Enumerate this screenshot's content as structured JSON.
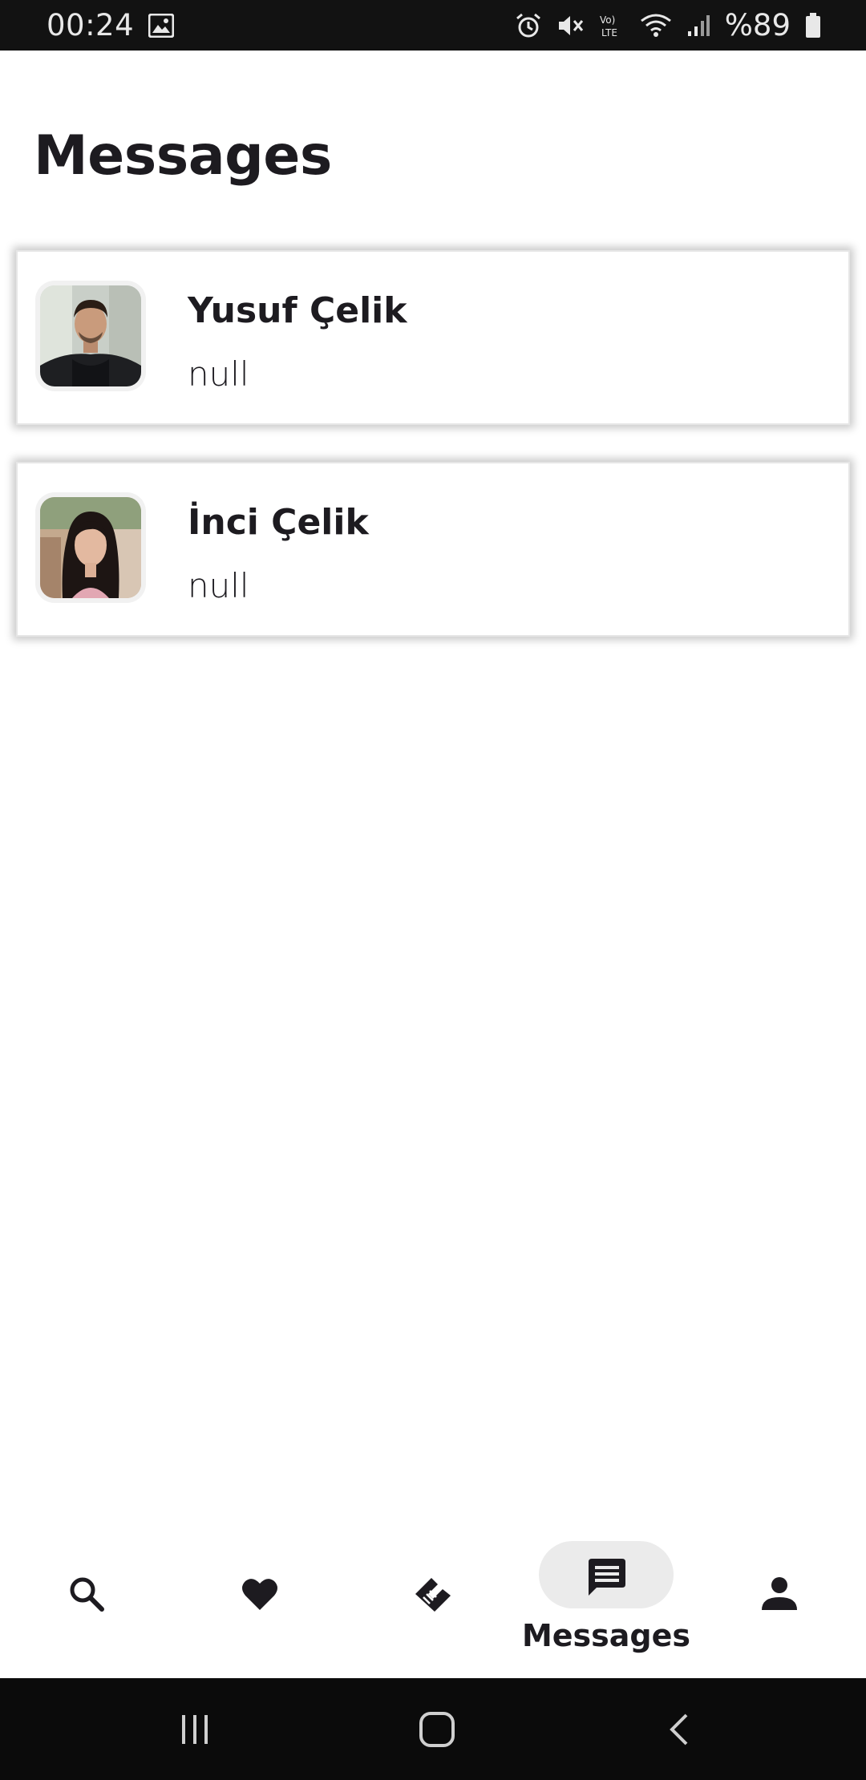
{
  "status_bar": {
    "time": "00:24",
    "battery_label": "%89",
    "icons": [
      "image-icon",
      "alarm-icon",
      "mute-icon",
      "volte-icon",
      "wifi-icon",
      "signal-icon",
      "battery-icon"
    ]
  },
  "page": {
    "title": "Messages"
  },
  "conversations": [
    {
      "name": "Yusuf Çelik",
      "last_message": "null",
      "avatar": "avatar-photo-man"
    },
    {
      "name": "İnci Çelik",
      "last_message": "null",
      "avatar": "avatar-photo-woman"
    }
  ],
  "bottom_nav": {
    "items": [
      {
        "icon": "search-icon",
        "label": "",
        "active": false
      },
      {
        "icon": "heart-icon",
        "label": "",
        "active": false
      },
      {
        "icon": "handshake-icon",
        "label": "",
        "active": false
      },
      {
        "icon": "message-icon",
        "label": "Messages",
        "active": true
      },
      {
        "icon": "person-icon",
        "label": "",
        "active": false
      }
    ],
    "active_indicator_color": "#ebebeb"
  },
  "system_nav": {
    "buttons": [
      "recents-icon",
      "home-icon",
      "back-icon"
    ]
  },
  "colors": {
    "text": "#1d1b20",
    "status_bar_bg": "#121212",
    "system_nav_bg": "#0b0b0b",
    "card_border": "#e6e6e6"
  }
}
